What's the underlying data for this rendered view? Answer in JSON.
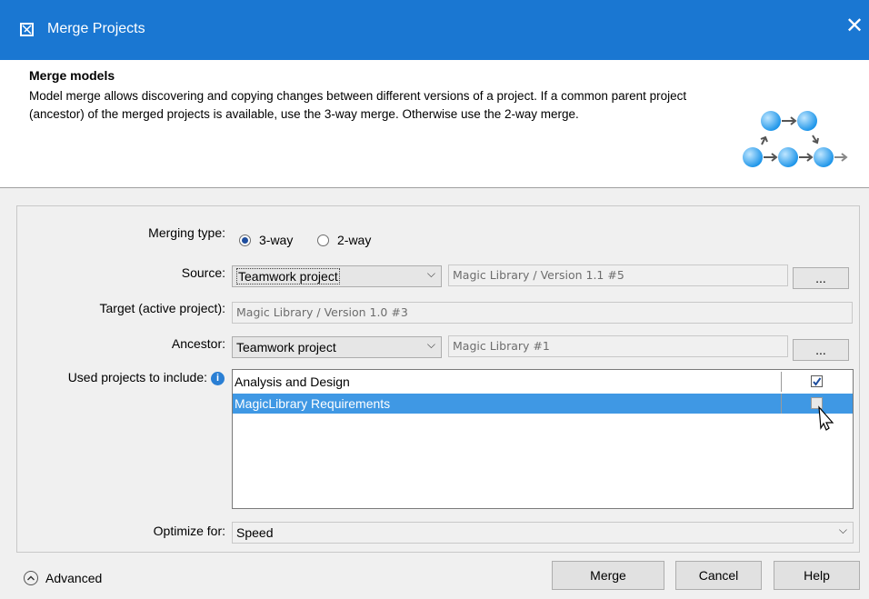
{
  "window": {
    "title": "Merge Projects",
    "close_glyph": "✕"
  },
  "header": {
    "title": "Merge models",
    "description": "Model merge allows discovering and copying changes between different versions of a project. If a common parent project (ancestor) of the merged projects is available, use the 3-way merge. Otherwise use the 2-way merge."
  },
  "form": {
    "merging_type": {
      "label": "Merging type:",
      "options": [
        "3-way",
        "2-way"
      ],
      "selected": "3-way"
    },
    "source": {
      "label": "Source:",
      "type_value": "Teamwork project",
      "project_value": "Magic Library / Version 1.1 #5",
      "browse_label": "..."
    },
    "target": {
      "label": "Target (active project):",
      "value": "Magic Library / Version 1.0 #3"
    },
    "ancestor": {
      "label": "Ancestor:",
      "type_value": "Teamwork project",
      "project_value": "Magic Library #1",
      "browse_label": "..."
    },
    "used_projects": {
      "label": "Used projects to include:",
      "rows": [
        {
          "name": "Analysis and Design",
          "checked": true,
          "selected": false
        },
        {
          "name": "MagicLibrary Requirements",
          "checked": false,
          "selected": true
        }
      ]
    },
    "optimize": {
      "label": "Optimize for:",
      "value": "Speed"
    }
  },
  "footer": {
    "advanced_label": "Advanced",
    "merge_label": "Merge",
    "cancel_label": "Cancel",
    "help_label": "Help"
  },
  "icons": {
    "app": "merge-projects-icon",
    "info": "info-icon",
    "dropdown": "chevron-down-icon",
    "advanced": "chevron-up-circle-icon"
  },
  "colors": {
    "titlebar": "#1a77d2",
    "selection": "#3f98e4"
  }
}
